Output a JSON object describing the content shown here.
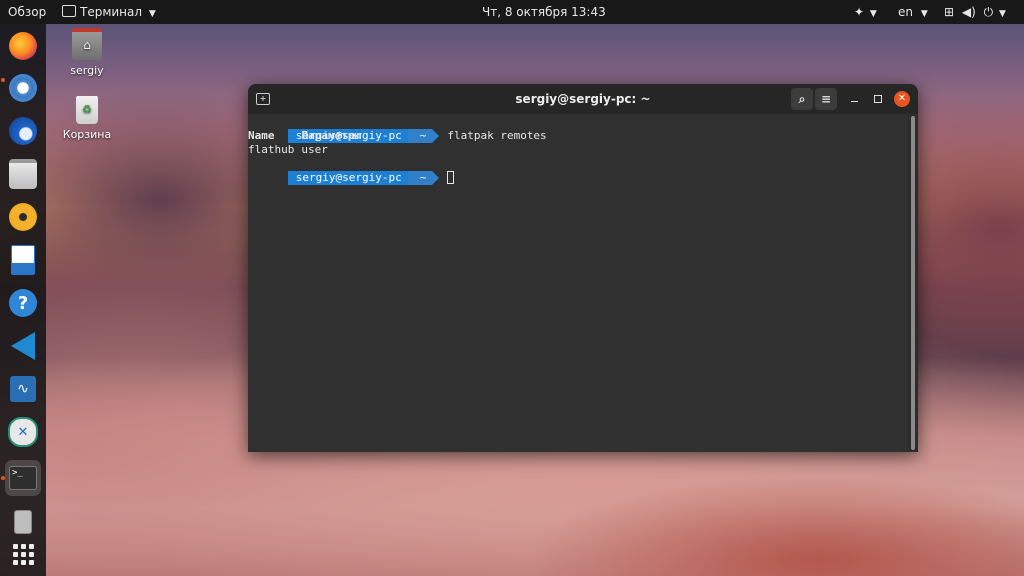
{
  "topbar": {
    "activities": "Обзор",
    "app_menu": "Терминал",
    "clock": "Чт, 8 октября  13:43",
    "language": "en"
  },
  "dock": {
    "items": [
      {
        "name": "firefox-icon"
      },
      {
        "name": "chromium-icon"
      },
      {
        "name": "thunderbird-icon"
      },
      {
        "name": "files-icon"
      },
      {
        "name": "rhythmbox-icon"
      },
      {
        "name": "writer-icon"
      },
      {
        "name": "help-icon"
      },
      {
        "name": "vscode-icon"
      },
      {
        "name": "system-monitor-icon"
      },
      {
        "name": "xfce-app-icon"
      },
      {
        "name": "terminal-icon"
      },
      {
        "name": "usb-drive-icon"
      },
      {
        "name": "show-apps-icon"
      }
    ]
  },
  "desktop": {
    "home_label": "sergiy",
    "trash_label": "Корзина"
  },
  "terminal": {
    "title": "sergiy@sergiy-pc: ~",
    "prompt_user": "sergiy@sergiy-pc",
    "prompt_dir": "~",
    "command": "flatpak remotes",
    "output_header": [
      "Name",
      "Параметры"
    ],
    "output_rows": [
      [
        "flathub",
        "user"
      ]
    ]
  },
  "colors": {
    "prompt_segment": "#1c7fd6",
    "close_button": "#e95420",
    "dock_active_dot": "#e95420"
  }
}
